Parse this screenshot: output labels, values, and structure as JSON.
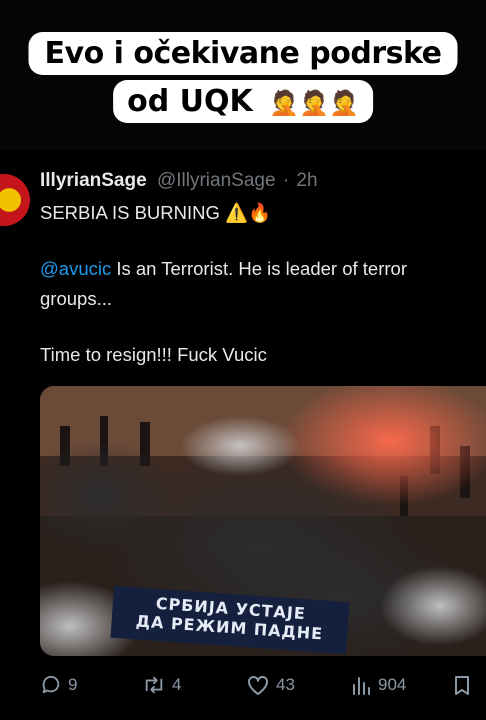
{
  "overlay": {
    "line1": "Evo i očekivane podrske",
    "line2": "od UQK",
    "emojis": "🤦🤦🤦"
  },
  "tweet": {
    "display_name": "IllyrianSage",
    "handle": "@IllyrianSage",
    "separator": "·",
    "time": "2h",
    "line1": "SERBIA IS BURNING ⚠️🔥",
    "mention": "@avucic",
    "line2_rest": " Is an Terrorist. He is leader of terror",
    "line3": "groups...",
    "line4": "Time to resign!!! Fuck Vucic",
    "media": {
      "banner_line1": "СРБИЈА УСТАЈЕ",
      "banner_line2": "ДА РЕЖИМ ПАДНЕ"
    },
    "stats": {
      "replies": "9",
      "reposts": "4",
      "likes": "43",
      "views": "904"
    },
    "icons": [
      "reply-icon",
      "repost-icon",
      "like-icon",
      "views-icon",
      "bookmark-icon"
    ]
  },
  "colors": {
    "background": "#000000",
    "text": "#e7e9ea",
    "muted": "#71767b",
    "link": "#1d9bf0",
    "caption_bg": "#ffffff"
  }
}
